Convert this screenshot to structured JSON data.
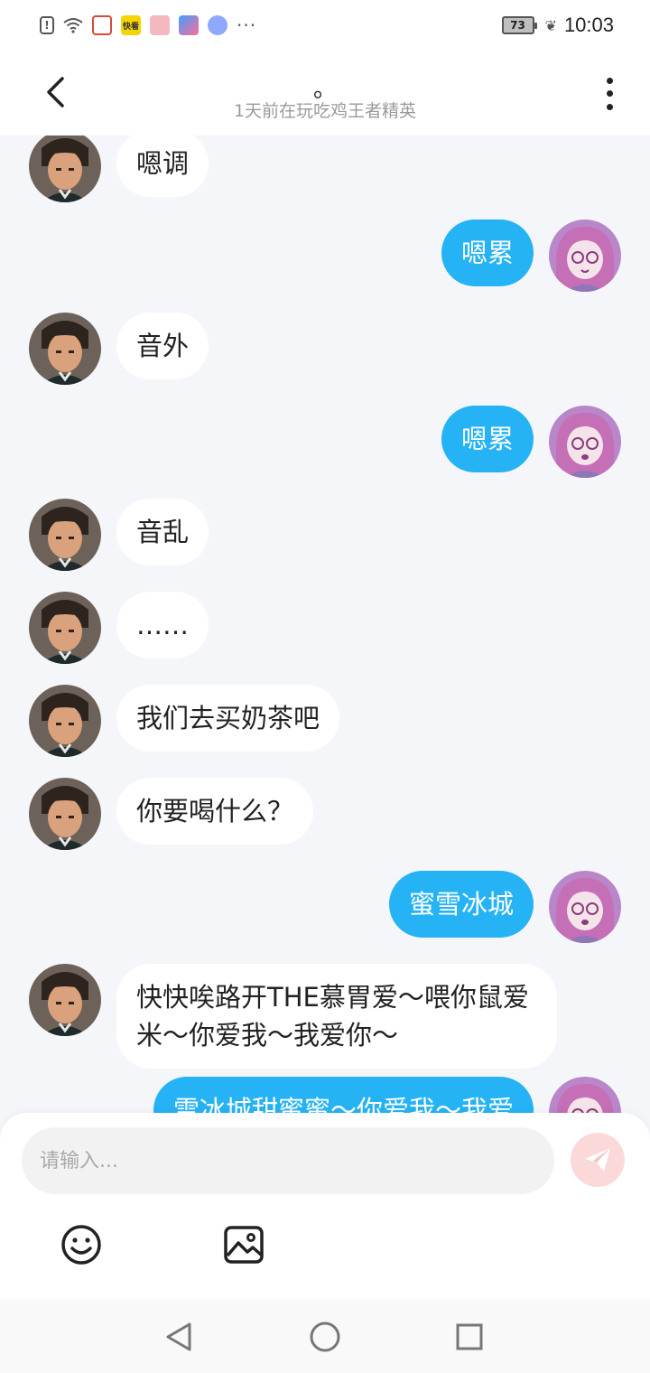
{
  "status_bar": {
    "battery": "73",
    "time": "10:03",
    "app_badge": "快看",
    "more": "···",
    "alert_glyph": "!",
    "leaf_glyph": "❦"
  },
  "header": {
    "title": "。",
    "subtitle": "1天前在玩吃鸡王者精英"
  },
  "messages": [
    {
      "side": "left",
      "text": "嗯调"
    },
    {
      "side": "right",
      "text": "嗯累"
    },
    {
      "side": "left",
      "text": "音外"
    },
    {
      "side": "right",
      "text": "嗯累"
    },
    {
      "side": "left",
      "text": "音乱"
    },
    {
      "side": "left",
      "text": "……"
    },
    {
      "side": "left",
      "text": "我们去买奶茶吧"
    },
    {
      "side": "left",
      "text": "你要喝什么？"
    },
    {
      "side": "right",
      "text": "蜜雪冰城"
    },
    {
      "side": "left",
      "text": "快快唉路开THE慕胃爱～喂你鼠爱米～你爱我～我爱你～"
    },
    {
      "side": "right",
      "text": "雪冰城甜蜜蜜～你爱我～我爱"
    }
  ],
  "input": {
    "placeholder": "请输入..."
  },
  "icons": {
    "back": "chevron-left-icon",
    "more": "more-vertical-icon",
    "send": "send-icon",
    "emoji": "emoji-icon",
    "image": "image-icon"
  },
  "colors": {
    "own_bubble": "#25b3f5",
    "other_bubble": "#ffffff",
    "background": "#f4f6f9",
    "send_button": "#fbd9d9"
  }
}
